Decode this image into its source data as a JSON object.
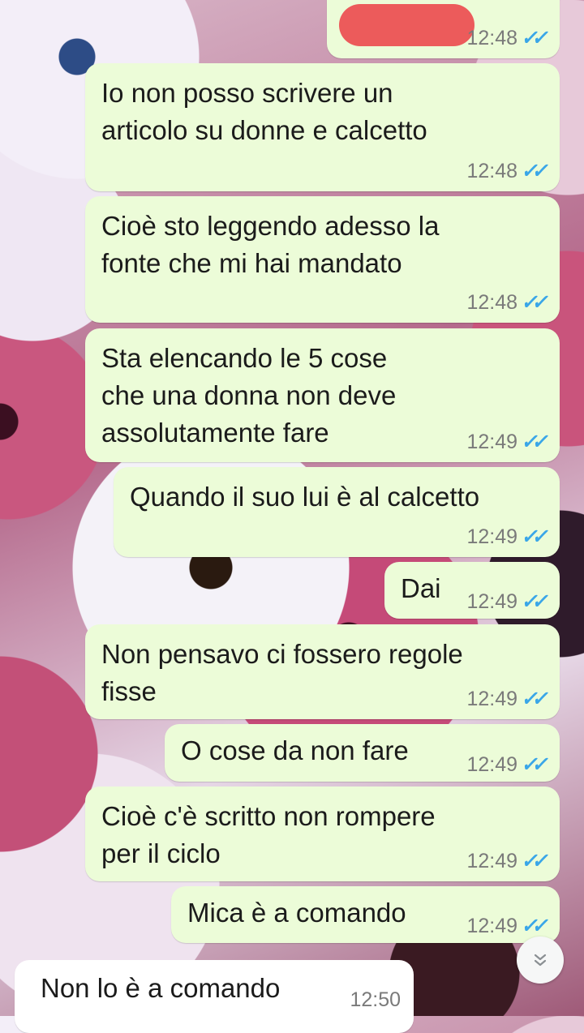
{
  "messages": [
    {
      "text": "",
      "time": "12:48",
      "ticks": "✓✓"
    },
    {
      "text": "Io non posso scrivere un\narticolo su donne e calcetto",
      "time": "12:48",
      "ticks": "✓✓"
    },
    {
      "text": "Cioè sto leggendo adesso la\nfonte che mi hai mandato",
      "time": "12:48",
      "ticks": "✓✓"
    },
    {
      "text": "Sta elencando le 5 cose\nche una donna non deve\nassolutamente fare",
      "time": "12:49",
      "ticks": "✓✓"
    },
    {
      "text": "Quando il suo lui è al calcetto",
      "time": "12:49",
      "ticks": "✓✓"
    },
    {
      "text": "Dai",
      "time": "12:49",
      "ticks": "✓✓"
    },
    {
      "text": "Non pensavo ci fossero regole\nfisse",
      "time": "12:49",
      "ticks": "✓✓"
    },
    {
      "text": "O cose da non fare",
      "time": "12:49",
      "ticks": "✓✓"
    },
    {
      "text": "Cioè c'è scritto non rompere\nper il ciclo",
      "time": "12:49",
      "ticks": "✓✓"
    },
    {
      "text": "Mica è a comando",
      "time": "12:49",
      "ticks": "✓✓"
    },
    {
      "text": "Non lo è a comando",
      "time": "12:50"
    }
  ],
  "scroll_down_icon": "double-chevron-down-icon",
  "colors": {
    "outgoing_bubble": "#ecfcd8",
    "incoming_bubble": "#ffffff",
    "read_ticks": "#3aa6e8",
    "redaction": "#ec5b5b"
  }
}
